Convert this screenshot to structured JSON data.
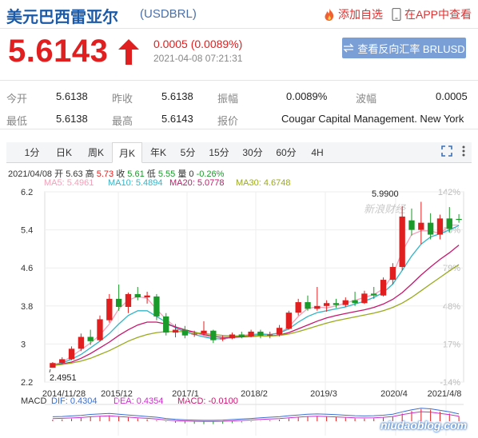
{
  "header": {
    "title": "美元巴西雷亚尔",
    "code": "(USDBRL)",
    "add_watch": "添加自选",
    "app_view": "在APP中查看"
  },
  "quote": {
    "price": "5.6143",
    "change": "0.0005 (0.0089%)",
    "time": "2021-04-08 07:21:31",
    "reverse_button": "查看反向汇率 BRLUSD"
  },
  "stats": [
    {
      "label": "今开",
      "value": "5.6138"
    },
    {
      "label": "昨收",
      "value": "5.6138"
    },
    {
      "label": "振幅",
      "value": "0.0089%"
    },
    {
      "label": "波幅",
      "value": "0.0005"
    },
    {
      "label": "最低",
      "value": "5.6138"
    },
    {
      "label": "最高",
      "value": "5.6143"
    },
    {
      "label": "报价",
      "value": "Cougar Capital Management. New York"
    }
  ],
  "tabs": [
    "1分",
    "日K",
    "周K",
    "月K",
    "年K",
    "5分",
    "15分",
    "30分",
    "60分",
    "4H"
  ],
  "active_tab": "月K",
  "kline_info": {
    "date": "2021/04/08",
    "open_label": "开",
    "open": "5.63",
    "high_label": "高",
    "high": "5.73",
    "close_label": "收",
    "close": "5.61",
    "low_label": "低",
    "low": "5.55",
    "vol_label": "量",
    "vol": "0",
    "change": "-0.26%"
  },
  "ma": [
    {
      "label": "MA5: 5.4961",
      "color": "#f5a0ba"
    },
    {
      "label": "MA10: 5.4894",
      "color": "#33b5c8"
    },
    {
      "label": "MA20: 5.0778",
      "color": "#c8166f"
    },
    {
      "label": "MA30: 4.6748",
      "color": "#9aaa1c"
    }
  ],
  "macd": {
    "label": "MACD",
    "dif": "DIF: 0.4304",
    "dea": "DEA: 0.4354",
    "macd": "MACD: -0.0100",
    "dif_color": "#3a6fd0",
    "dea_color": "#c832c8",
    "macd_color": "#c8166f"
  },
  "chart_data": {
    "type": "candlestick",
    "y_ticks": [
      "6.2",
      "5.4",
      "4.6",
      "3.8",
      "3",
      "2.2"
    ],
    "y_values": [
      6.2,
      5.4,
      4.6,
      3.8,
      3.0,
      2.2
    ],
    "ylim": [
      2.2,
      6.2
    ],
    "pct_ticks": [
      "142%",
      "110%",
      "79%",
      "48%",
      "17%",
      "-14%"
    ],
    "x_ticks": [
      "2014/11/28",
      "2015/12",
      "2017/1",
      "2018/2",
      "2019/3",
      "2020/4",
      "2021/4/8"
    ],
    "max_label": "5.9900",
    "min_label": "2.4951",
    "watermark": "新浪财经",
    "series": [
      {
        "name": "MA5",
        "values": [
          2.56,
          2.62,
          2.74,
          2.88,
          3.02,
          3.19,
          3.42,
          3.74,
          3.92,
          4.0,
          3.96,
          3.73,
          3.52,
          3.36,
          3.27,
          3.24,
          3.18,
          3.12,
          3.1,
          3.14,
          3.18,
          3.2,
          3.22,
          3.2,
          3.23,
          3.36,
          3.58,
          3.75,
          3.78,
          3.76,
          3.8,
          3.86,
          3.92,
          3.98,
          4.04,
          4.16,
          4.45,
          4.95,
          5.3,
          5.38,
          5.38,
          5.32,
          5.5,
          5.5
        ]
      },
      {
        "name": "MA10",
        "values": [
          2.55,
          2.6,
          2.68,
          2.78,
          2.92,
          3.06,
          3.22,
          3.42,
          3.6,
          3.7,
          3.7,
          3.58,
          3.46,
          3.34,
          3.25,
          3.2,
          3.15,
          3.11,
          3.11,
          3.14,
          3.17,
          3.19,
          3.2,
          3.2,
          3.23,
          3.32,
          3.46,
          3.58,
          3.66,
          3.7,
          3.74,
          3.78,
          3.84,
          3.9,
          3.98,
          4.08,
          4.26,
          4.55,
          4.85,
          5.1,
          5.25,
          5.32,
          5.4,
          5.49
        ]
      },
      {
        "name": "MA20",
        "values": [
          2.55,
          2.58,
          2.62,
          2.7,
          2.8,
          2.92,
          3.04,
          3.18,
          3.3,
          3.4,
          3.46,
          3.46,
          3.42,
          3.36,
          3.3,
          3.25,
          3.2,
          3.16,
          3.14,
          3.14,
          3.15,
          3.16,
          3.17,
          3.17,
          3.19,
          3.24,
          3.32,
          3.4,
          3.48,
          3.55,
          3.6,
          3.64,
          3.68,
          3.72,
          3.77,
          3.84,
          3.94,
          4.08,
          4.26,
          4.45,
          4.62,
          4.78,
          4.92,
          5.08
        ]
      },
      {
        "name": "MA30",
        "values": [
          2.55,
          2.57,
          2.6,
          2.64,
          2.7,
          2.78,
          2.86,
          2.96,
          3.06,
          3.14,
          3.2,
          3.24,
          3.26,
          3.26,
          3.26,
          3.24,
          3.22,
          3.2,
          3.18,
          3.17,
          3.17,
          3.17,
          3.17,
          3.17,
          3.18,
          3.21,
          3.26,
          3.32,
          3.38,
          3.44,
          3.49,
          3.53,
          3.57,
          3.61,
          3.65,
          3.7,
          3.77,
          3.86,
          3.98,
          4.12,
          4.26,
          4.4,
          4.54,
          4.67
        ]
      }
    ],
    "candles": [
      {
        "o": 2.5,
        "h": 2.62,
        "l": 2.5,
        "c": 2.6
      },
      {
        "o": 2.6,
        "h": 2.72,
        "l": 2.58,
        "c": 2.68
      },
      {
        "o": 2.68,
        "h": 2.95,
        "l": 2.66,
        "c": 2.9
      },
      {
        "o": 2.9,
        "h": 3.22,
        "l": 2.85,
        "c": 3.15
      },
      {
        "o": 3.15,
        "h": 3.3,
        "l": 2.98,
        "c": 3.06
      },
      {
        "o": 3.08,
        "h": 3.6,
        "l": 3.05,
        "c": 3.52
      },
      {
        "o": 3.5,
        "h": 4.05,
        "l": 3.45,
        "c": 3.95
      },
      {
        "o": 3.95,
        "h": 4.25,
        "l": 3.7,
        "c": 3.78
      },
      {
        "o": 3.78,
        "h": 4.08,
        "l": 3.65,
        "c": 4.05
      },
      {
        "o": 4.05,
        "h": 4.2,
        "l": 3.92,
        "c": 3.98
      },
      {
        "o": 3.98,
        "h": 4.1,
        "l": 3.85,
        "c": 4.02
      },
      {
        "o": 4.0,
        "h": 4.05,
        "l": 3.5,
        "c": 3.58
      },
      {
        "o": 3.58,
        "h": 3.65,
        "l": 3.18,
        "c": 3.24
      },
      {
        "o": 3.24,
        "h": 3.42,
        "l": 3.14,
        "c": 3.3
      },
      {
        "o": 3.3,
        "h": 3.38,
        "l": 3.12,
        "c": 3.18
      },
      {
        "o": 3.2,
        "h": 3.28,
        "l": 3.15,
        "c": 3.22
      },
      {
        "o": 3.22,
        "h": 3.48,
        "l": 3.18,
        "c": 3.28
      },
      {
        "o": 3.28,
        "h": 3.3,
        "l": 3.02,
        "c": 3.08
      },
      {
        "o": 3.1,
        "h": 3.18,
        "l": 3.06,
        "c": 3.12
      },
      {
        "o": 3.12,
        "h": 3.24,
        "l": 3.1,
        "c": 3.2
      },
      {
        "o": 3.2,
        "h": 3.26,
        "l": 3.12,
        "c": 3.16
      },
      {
        "o": 3.16,
        "h": 3.3,
        "l": 3.14,
        "c": 3.26
      },
      {
        "o": 3.26,
        "h": 3.3,
        "l": 3.12,
        "c": 3.18
      },
      {
        "o": 3.18,
        "h": 3.26,
        "l": 3.12,
        "c": 3.2
      },
      {
        "o": 3.2,
        "h": 3.4,
        "l": 3.16,
        "c": 3.34
      },
      {
        "o": 3.32,
        "h": 3.7,
        "l": 3.3,
        "c": 3.66
      },
      {
        "o": 3.66,
        "h": 3.95,
        "l": 3.6,
        "c": 3.88
      },
      {
        "o": 3.88,
        "h": 4.02,
        "l": 3.7,
        "c": 3.74
      },
      {
        "o": 3.74,
        "h": 4.2,
        "l": 3.7,
        "c": 3.8
      },
      {
        "o": 3.8,
        "h": 3.92,
        "l": 3.68,
        "c": 3.86
      },
      {
        "o": 3.86,
        "h": 3.95,
        "l": 3.76,
        "c": 3.82
      },
      {
        "o": 3.82,
        "h": 3.98,
        "l": 3.78,
        "c": 3.92
      },
      {
        "o": 3.92,
        "h": 4.1,
        "l": 3.8,
        "c": 3.86
      },
      {
        "o": 3.86,
        "h": 4.12,
        "l": 3.84,
        "c": 4.06
      },
      {
        "o": 4.06,
        "h": 4.2,
        "l": 3.95,
        "c": 4.02
      },
      {
        "o": 4.02,
        "h": 4.4,
        "l": 4.0,
        "c": 4.35
      },
      {
        "o": 4.35,
        "h": 4.7,
        "l": 4.25,
        "c": 4.62
      },
      {
        "o": 4.62,
        "h": 5.9,
        "l": 4.55,
        "c": 5.68
      },
      {
        "o": 5.6,
        "h": 5.85,
        "l": 5.28,
        "c": 5.4
      },
      {
        "o": 5.4,
        "h": 5.99,
        "l": 5.1,
        "c": 5.55
      },
      {
        "o": 5.55,
        "h": 5.75,
        "l": 5.2,
        "c": 5.3
      },
      {
        "o": 5.3,
        "h": 5.72,
        "l": 5.2,
        "c": 5.64
      },
      {
        "o": 5.64,
        "h": 5.88,
        "l": 5.35,
        "c": 5.42
      },
      {
        "o": 5.63,
        "h": 5.73,
        "l": 5.55,
        "c": 5.61
      }
    ]
  }
}
